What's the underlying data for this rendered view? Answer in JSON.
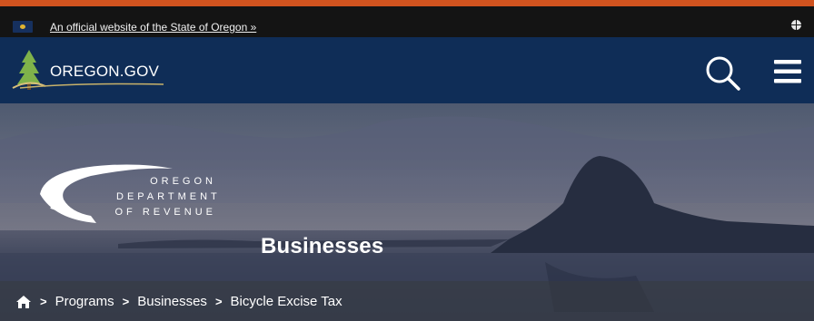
{
  "official_banner": {
    "text": "An official website of the State of Oregon »"
  },
  "site": {
    "logo_text": "OREGON.GOV"
  },
  "icons": {
    "flag": "oregon-flag-icon",
    "globe": "globe-icon",
    "search": "search-icon",
    "menu": "hamburger-menu-icon",
    "home": "home-icon"
  },
  "department": {
    "line1": "OREGON",
    "line2": "DEPARTMENT",
    "line3": "OF REVENUE"
  },
  "hero": {
    "title": "Businesses"
  },
  "breadcrumb": {
    "items": [
      "Programs",
      "Businesses",
      "Bicycle Excise Tax"
    ],
    "separator": ">"
  },
  "colors": {
    "accent": "#d1531f",
    "banner_bg": "#141414",
    "nav_bg": "#0f2d57"
  }
}
